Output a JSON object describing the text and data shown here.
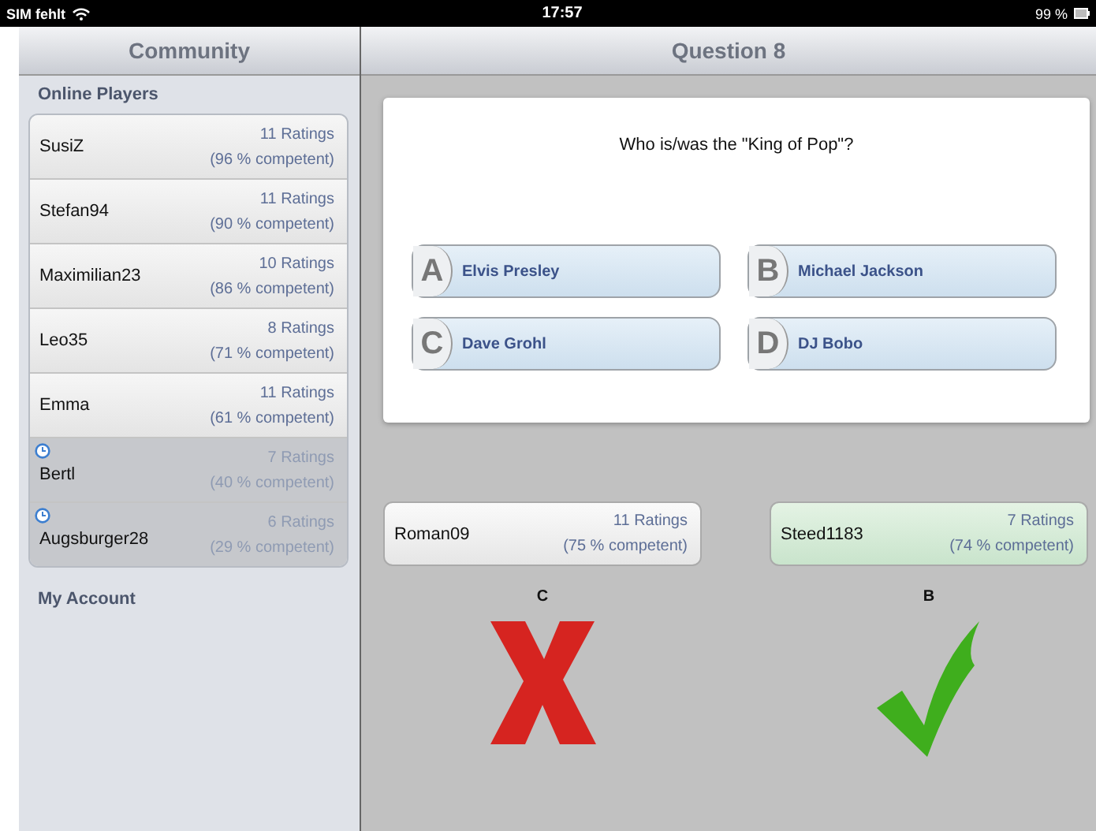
{
  "status_bar": {
    "carrier": "SIM fehlt",
    "time": "17:57",
    "battery": "99 %"
  },
  "sidebar": {
    "title": "Community",
    "sections": [
      {
        "title": "Online Players",
        "players": [
          {
            "name": "SusiZ",
            "ratings": "11 Ratings",
            "competence": "(96 % competent)",
            "waiting": false
          },
          {
            "name": "Stefan94",
            "ratings": "11 Ratings",
            "competence": "(90 % competent)",
            "waiting": false
          },
          {
            "name": "Maximilian23",
            "ratings": "10 Ratings",
            "competence": "(86 % competent)",
            "waiting": false
          },
          {
            "name": "Leo35",
            "ratings": "8 Ratings",
            "competence": "(71 % competent)",
            "waiting": false
          },
          {
            "name": "Emma",
            "ratings": "11 Ratings",
            "competence": "(61 % competent)",
            "waiting": false
          },
          {
            "name": "Bertl",
            "ratings": "7 Ratings",
            "competence": "(40 % competent)",
            "waiting": true
          },
          {
            "name": "Augsburger28",
            "ratings": "6 Ratings",
            "competence": "(29 % competent)",
            "waiting": true
          }
        ]
      },
      {
        "title": "My Account"
      }
    ]
  },
  "main": {
    "title": "Question 8",
    "question": "Who is/was the \"King of Pop\"?",
    "answers": [
      {
        "letter": "A",
        "text": "Elvis Presley"
      },
      {
        "letter": "B",
        "text": "Michael Jackson"
      },
      {
        "letter": "C",
        "text": "Dave Grohl"
      },
      {
        "letter": "D",
        "text": "DJ Bobo"
      }
    ],
    "results": [
      {
        "name": "Roman09",
        "ratings": "11 Ratings",
        "competence": "(75 % competent)",
        "answer": "C",
        "correct": false
      },
      {
        "name": "Steed1183",
        "ratings": "7 Ratings",
        "competence": "(74 % competent)",
        "answer": "B",
        "correct": true
      }
    ]
  }
}
